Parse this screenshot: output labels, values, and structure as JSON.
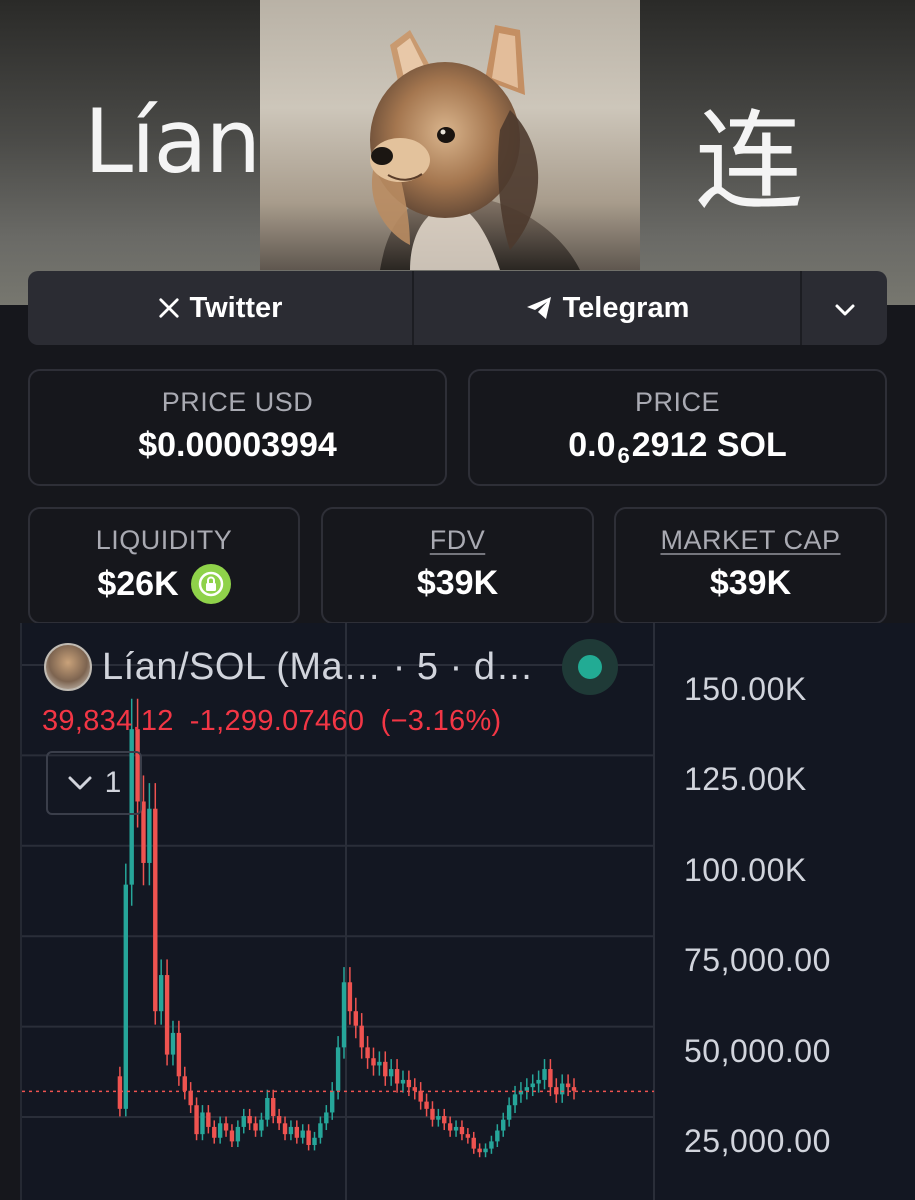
{
  "banner": {
    "left_text": "Lían",
    "right_text": "连"
  },
  "social": {
    "twitter_label": "Twitter",
    "telegram_label": "Telegram"
  },
  "stats": {
    "price_usd_label": "PRICE USD",
    "price_usd_value": "$0.00003994",
    "price_label": "PRICE",
    "price_prefix": "0.0",
    "price_zero_count": "6",
    "price_suffix": "2912 SOL",
    "liquidity_label": "LIQUIDITY",
    "liquidity_value": "$26K",
    "fdv_label": "FDV",
    "fdv_value": "$39K",
    "mcap_label": "MARKET CAP",
    "mcap_value": "$39K"
  },
  "chart": {
    "pair_title": "Lían/SOL (Ma… · 5 · d…",
    "last_value": "39,834.12",
    "change": "-1,299.07460",
    "change_pct": "(−3.16%)",
    "indicator_count": "1",
    "colors": {
      "up": "#26a69a",
      "down": "#ef5350",
      "last_line": "#ef5350",
      "grid": "#2a2e39"
    }
  },
  "chart_data": {
    "type": "line",
    "title": "",
    "y_ticks": [
      "150.00K",
      "125.00K",
      "100.00K",
      "75,000.00",
      "50,000.00",
      "25,000.00"
    ],
    "ylim": [
      18000,
      158000
    ],
    "last_price_line": 39834.12,
    "series": [
      {
        "values": [
          44000,
          35000,
          97000,
          140000,
          120000,
          103000,
          118000,
          62000,
          72000,
          50000,
          56000,
          44000,
          40000,
          36000,
          28000,
          34000,
          30000,
          27000,
          31000,
          29000,
          26000,
          30000,
          33000,
          31000,
          29000,
          32000,
          38000,
          33000,
          31000,
          28000,
          30000,
          27000,
          29000,
          25000,
          27000,
          31000,
          34000,
          40000,
          52000,
          70000,
          62000,
          58000,
          52000,
          49000,
          47000,
          48000,
          44000,
          46000,
          42000,
          43000,
          41000,
          40000,
          37000,
          35000,
          32000,
          33000,
          31000,
          29000,
          30000,
          28000,
          27000,
          24000,
          23000,
          24000,
          26000,
          29000,
          32000,
          36000,
          39000,
          40000,
          41000,
          42000,
          43000,
          46000,
          41000,
          39000,
          42000,
          41000,
          40000
        ]
      }
    ]
  }
}
